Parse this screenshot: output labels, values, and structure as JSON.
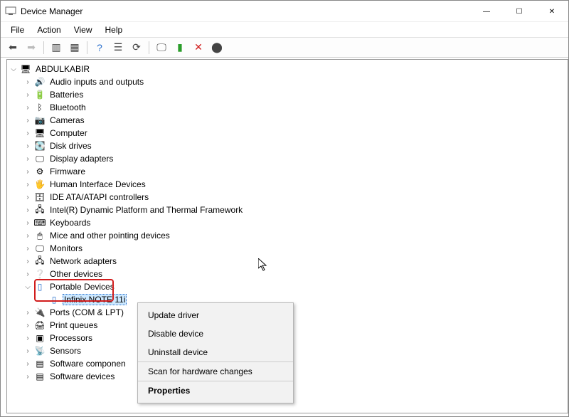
{
  "window": {
    "title": "Device Manager",
    "controls": {
      "min": "—",
      "max": "☐",
      "close": "✕"
    }
  },
  "menu": {
    "file": "File",
    "action": "Action",
    "view": "View",
    "help": "Help"
  },
  "root": "ABDULKABIR",
  "nodes": [
    {
      "label": "Audio inputs and outputs",
      "icon": "🔊"
    },
    {
      "label": "Batteries",
      "icon": "🔋"
    },
    {
      "label": "Bluetooth",
      "icon": "ᛒ"
    },
    {
      "label": "Cameras",
      "icon": "📷"
    },
    {
      "label": "Computer",
      "icon": "🖥"
    },
    {
      "label": "Disk drives",
      "icon": "💽"
    },
    {
      "label": "Display adapters",
      "icon": "🖵"
    },
    {
      "label": "Firmware",
      "icon": "⚙"
    },
    {
      "label": "Human Interface Devices",
      "icon": "🖐"
    },
    {
      "label": "IDE ATA/ATAPI controllers",
      "icon": "🗄"
    },
    {
      "label": "Intel(R) Dynamic Platform and Thermal Framework",
      "icon": "🖧"
    },
    {
      "label": "Keyboards",
      "icon": "⌨"
    },
    {
      "label": "Mice and other pointing devices",
      "icon": "🖱"
    },
    {
      "label": "Monitors",
      "icon": "🖵"
    },
    {
      "label": "Network adapters",
      "icon": "🖧"
    },
    {
      "label": "Other devices",
      "icon": "❔"
    }
  ],
  "portable": {
    "label": "Portable Devices",
    "child": "Infinix NOTE 11i"
  },
  "nodes_after": [
    {
      "label": "Ports (COM & LPT)",
      "icon": "🔌"
    },
    {
      "label": "Print queues",
      "icon": "🖨"
    },
    {
      "label": "Processors",
      "icon": "▣"
    },
    {
      "label": "Sensors",
      "icon": "📡"
    },
    {
      "label": "Software componen",
      "icon": "▤",
      "truncated": true
    },
    {
      "label": "Software devices",
      "icon": "▤",
      "truncated": true
    }
  ],
  "context": {
    "update": "Update driver",
    "disable": "Disable device",
    "uninstall": "Uninstall device",
    "scan": "Scan for hardware changes",
    "properties": "Properties"
  }
}
